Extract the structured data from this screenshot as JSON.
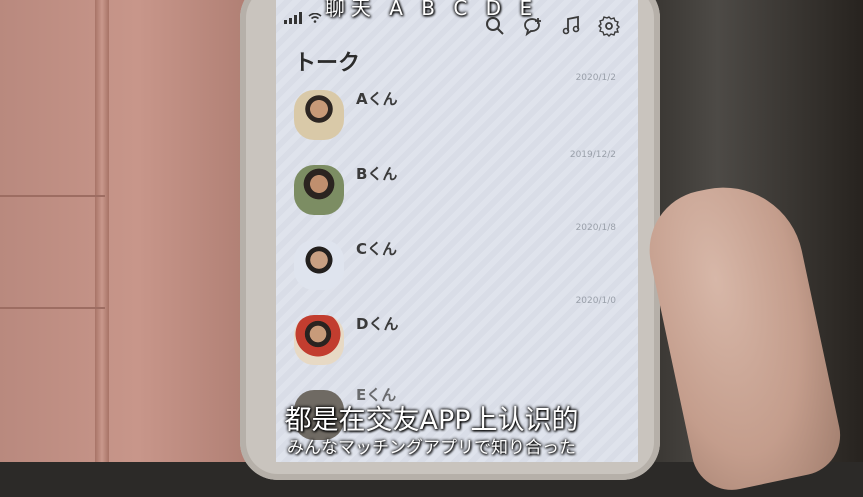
{
  "overlay": {
    "top_text": "聊天 A B C D E",
    "subtitle_chinese": "都是在交友APP上认识的",
    "subtitle_japanese": "みんなマッチングアプリで知り合った"
  },
  "app": {
    "title": "トーク",
    "toolbar": {
      "icons": [
        "search-icon",
        "add-chat-icon",
        "music-icon",
        "settings-icon"
      ]
    },
    "chats": [
      {
        "name": "Aくん",
        "date": "2020/1/2"
      },
      {
        "name": "Bくん",
        "date": "2019/12/2"
      },
      {
        "name": "Cくん",
        "date": "2020/1/8"
      },
      {
        "name": "Dくん",
        "date": "2020/1/0"
      },
      {
        "name": "Eくん",
        "date": ""
      }
    ]
  }
}
